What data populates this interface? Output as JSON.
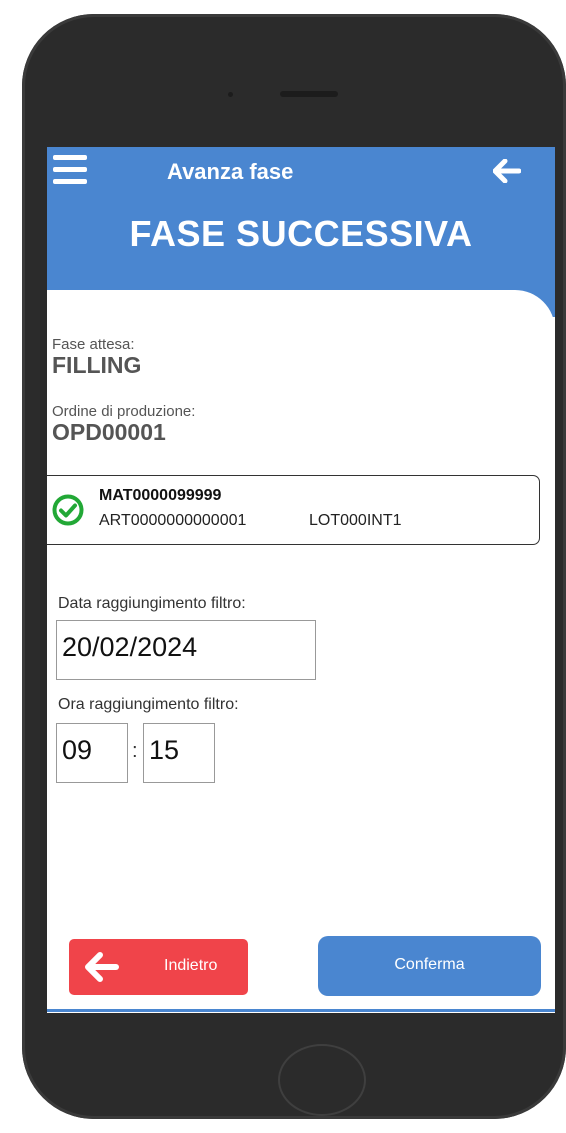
{
  "header": {
    "title": "Avanza fase",
    "page_title": "FASE SUCCESSIVA",
    "menu_icon": "hamburger-menu-icon",
    "back_icon": "arrow-left-icon"
  },
  "info": {
    "phase_label": "Fase attesa:",
    "phase_value": "FILLING",
    "order_label": "Ordine di produzione:",
    "order_value": "OPD00001"
  },
  "material": {
    "status_icon": "check-circle-icon",
    "code": "MAT0000099999",
    "article": "ART0000000000001",
    "lot": "LOT000INT1"
  },
  "form": {
    "date_label": "Data raggiungimento filtro:",
    "date_value": "20/02/2024",
    "time_label": "Ora raggiungimento filtro:",
    "hour_value": "09",
    "separator": ":",
    "minute_value": "15"
  },
  "actions": {
    "back_label": "Indietro",
    "confirm_label": "Conferma"
  },
  "colors": {
    "primary": "#4a86d0",
    "danger": "#f0444a",
    "success": "#22a836"
  }
}
